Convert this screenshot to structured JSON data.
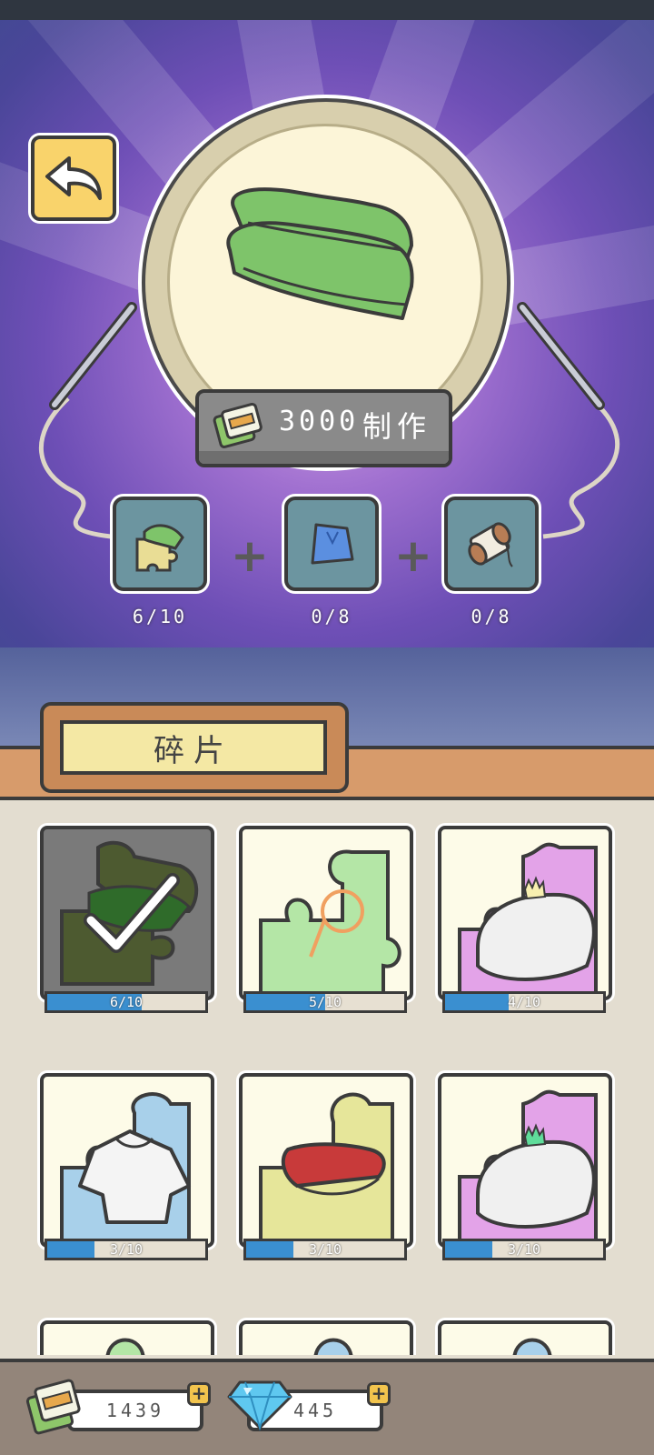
{
  "crafting": {
    "cost": "3000",
    "make_label": "制作",
    "materials": [
      {
        "icon": "shoe-puzzle-piece-icon",
        "count": "6/10"
      },
      {
        "icon": "blue-cloth-icon",
        "count": "0/8"
      },
      {
        "icon": "thread-spool-icon",
        "count": "0/8"
      }
    ]
  },
  "tab": {
    "label": "碎片"
  },
  "fragments": [
    {
      "icon": "green-shoes-piece-icon",
      "progress_text": "6/10",
      "progress": 0.6,
      "selected": true
    },
    {
      "icon": "magnifier-piece-icon",
      "progress_text": "5/10",
      "progress": 0.5
    },
    {
      "icon": "white-hat-piece-icon",
      "progress_text": "4/10",
      "progress": 0.4
    },
    {
      "icon": "white-shirt-piece-icon",
      "progress_text": "3/10",
      "progress": 0.3
    },
    {
      "icon": "red-shoes-piece-icon",
      "progress_text": "3/10",
      "progress": 0.3
    },
    {
      "icon": "white-hat-green-piece-icon",
      "progress_text": "3/10",
      "progress": 0.3
    }
  ],
  "currency": {
    "clover_tickets": "1439",
    "gems": "445"
  },
  "colors": {
    "accent_blue": "#3a8fd0",
    "button_yellow": "#f9d36b",
    "background_purple": "#6e4fb6"
  }
}
